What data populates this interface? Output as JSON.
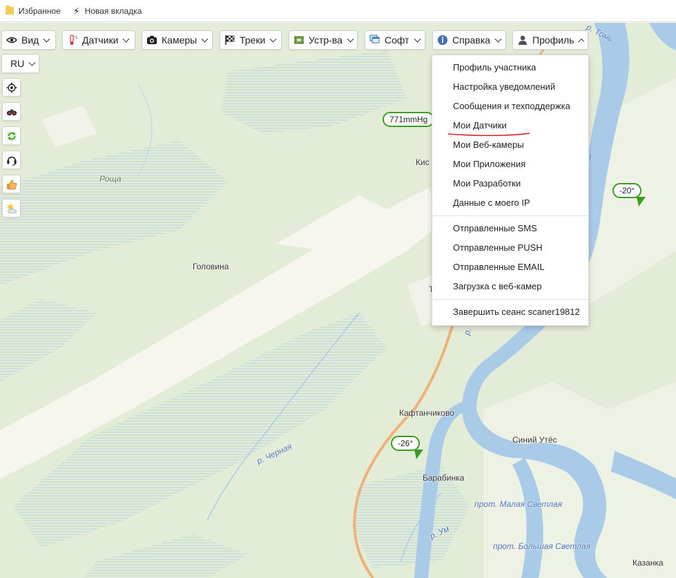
{
  "bookmarks": {
    "favorites": "Избранное",
    "new_tab": "Новая вкладка"
  },
  "toolbar": {
    "view": "Вид",
    "sensors": "Датчики",
    "cameras": "Камеры",
    "tracks": "Треки",
    "devices": "Устр-ва",
    "software": "Софт",
    "help": "Справка",
    "profile": "Профиль",
    "language": "RU"
  },
  "side_tools": [
    "locate-icon",
    "binoculars-icon",
    "refresh-icon",
    "headset-icon",
    "thumbs-up-icon",
    "weather-icon"
  ],
  "profile_menu": {
    "group1": [
      "Профиль участника",
      "Настройка уведомлений",
      "Сообщения и техподдержка",
      "Мои Датчики",
      "Мои Веб-камеры",
      "Мои Приложения",
      "Мои Разработки",
      "Данные с моего IP"
    ],
    "group2": [
      "Отправленные SMS",
      "Отправленные PUSH",
      "Отправленные EMAIL",
      "Загрузка с веб-камер"
    ],
    "group3": [
      "Завершить сеанс scaner19812"
    ],
    "highlighted": "Мои Датчики",
    "underline_color": "#d42020"
  },
  "map": {
    "places": {
      "roscha": "Роща",
      "golovina": "Головина",
      "kis": "Кис",
      "t": "Т",
      "kaftanchikovo": "Кафтанчиково",
      "siniy_utes": "Синий Утёс",
      "barabinka": "Барабинка",
      "kazanka": "Казанка"
    },
    "water": {
      "tom": "р. Томь",
      "chernaya": "р. Черная",
      "um": "р. Ум",
      "malaya_svetlaya": "прот. Малая Светлая",
      "bolshaya_svetlaya": "прот. Большая Светлая",
      "r_fragment": "р. Т",
      "ya_fragment": "я"
    },
    "markers": {
      "pressure": "771mmHg",
      "temp_east": "-20°",
      "temp_south": "-26°"
    },
    "colors": {
      "forest": "#e3ecd6",
      "clearing": "#f5f5f0",
      "water": "#aacbe8",
      "road": "#f0b07a",
      "marker_border": "#3a9d22"
    }
  }
}
